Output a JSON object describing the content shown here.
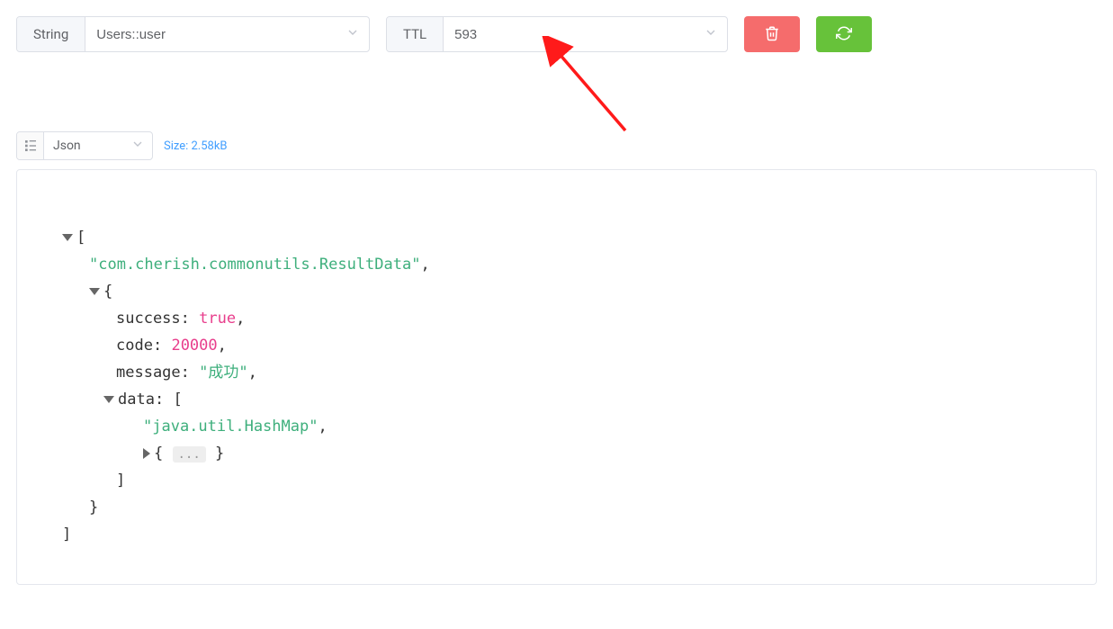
{
  "header": {
    "type_label": "String",
    "key_value": "Users::user",
    "ttl_label": "TTL",
    "ttl_value": "593"
  },
  "meta": {
    "view_mode": "Json",
    "size_label": "Size: 2.58kB"
  },
  "json_view": {
    "open_bracket": "[",
    "line_class": "\"com.cherish.commonutils.ResultData\"",
    "open_brace": "{",
    "k_success": "success",
    "v_success": "true",
    "k_code": "code",
    "v_code": "20000",
    "k_message": "message",
    "v_message": "\"成功\"",
    "k_data": "data",
    "open_bracket2": "[",
    "line_hashmap": "\"java.util.HashMap\"",
    "collapsed_obj_open": "{",
    "collapsed_obj_ellipsis": "...",
    "collapsed_obj_close": "}",
    "close_bracket2": "]",
    "close_brace": "}",
    "close_bracket": "]",
    "comma": ",",
    "colon": ":"
  }
}
